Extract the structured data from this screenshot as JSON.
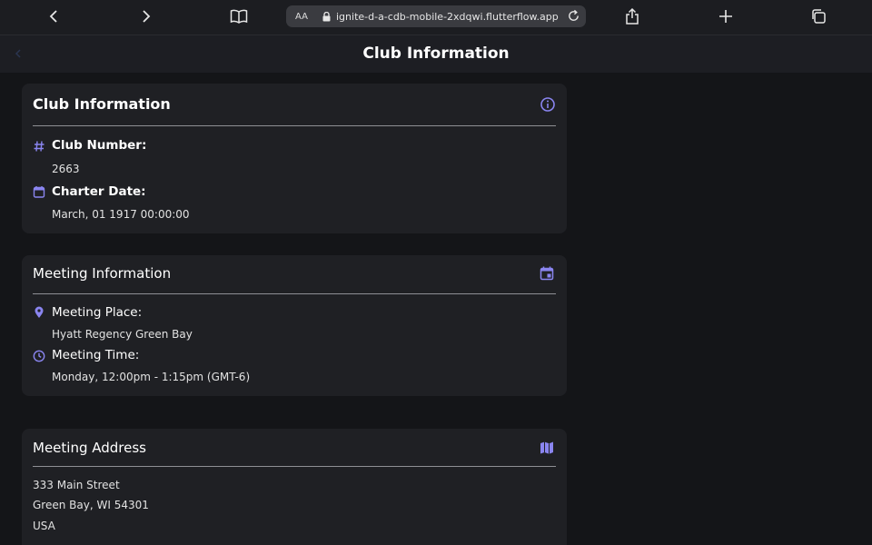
{
  "browser": {
    "text_size_label": "AA",
    "url": "ignite-d-a-cdb-mobile-2xdqwi.flutterflow.app"
  },
  "header": {
    "title": "Club Information"
  },
  "club_card": {
    "title": "Club Information",
    "club_number_label": "Club Number:",
    "club_number_value": "2663",
    "charter_date_label": "Charter Date:",
    "charter_date_value": "March, 01 1917 00:00:00"
  },
  "meeting_card": {
    "title": "Meeting Information",
    "place_label": "Meeting Place:",
    "place_value": "Hyatt Regency Green Bay",
    "time_label": "Meeting Time:",
    "time_value": "Monday, 12:00pm - 1:15pm  (GMT-6)"
  },
  "address_card": {
    "title": "Meeting Address",
    "lines": [
      "333 Main Street",
      "Green Bay, WI  54301",
      "USA"
    ]
  },
  "colors": {
    "accent": "#8a85f0",
    "background": "#141518",
    "card": "#1f2024"
  }
}
